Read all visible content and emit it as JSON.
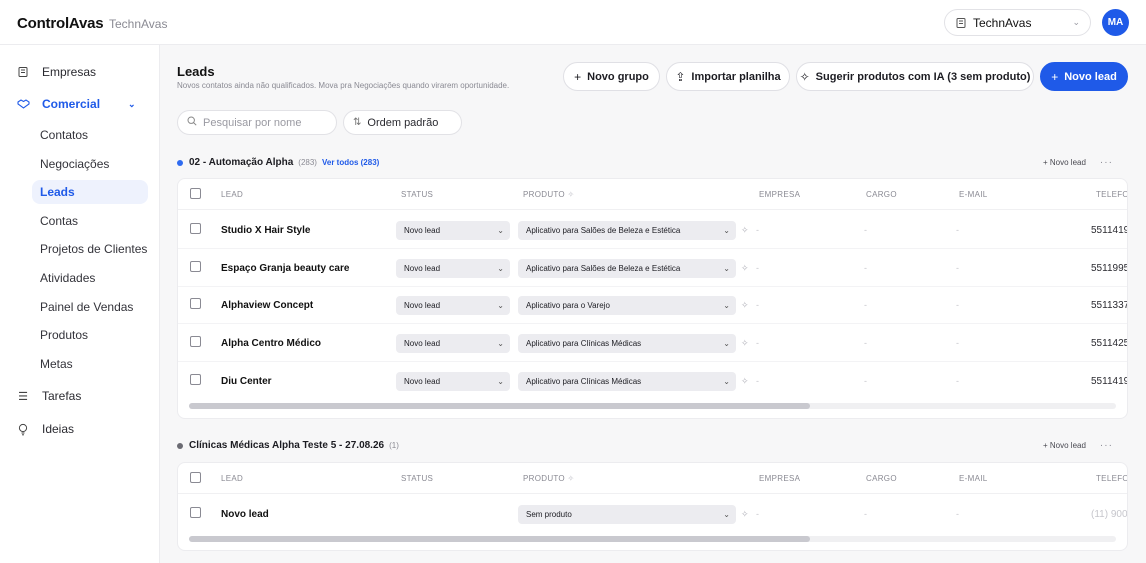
{
  "header": {
    "brand": "ControlAvas",
    "org_name": "TechnAvas",
    "org_select": "TechnAvas",
    "avatar": "MA"
  },
  "sidebar": {
    "empresas": "Empresas",
    "comercial": "Comercial",
    "sub_items": [
      "Contatos",
      "Negociações",
      "Leads",
      "Contas",
      "Projetos de Clientes",
      "Atividades",
      "Painel de Vendas",
      "Produtos",
      "Metas"
    ],
    "tarefas": "Tarefas",
    "ideias": "Ideias"
  },
  "page": {
    "title": "Leads",
    "subtitle": "Novos contatos ainda não qualificados. Mova pra Negociações quando virarem oportunidade.",
    "buttons": {
      "new_group": "Novo grupo",
      "import": "Importar planilha",
      "suggest": "Sugerir produtos com IA (3 sem produto)",
      "new_lead": "Novo lead"
    },
    "search_placeholder": "Pesquisar por nome",
    "order_label": "Ordem padrão"
  },
  "columns": [
    "LEAD",
    "STATUS",
    "PRODUTO",
    "EMPRESA",
    "CARGO",
    "E-MAIL",
    "TELEFO"
  ],
  "groups": [
    {
      "name": "02 - Automação Alpha",
      "count": "(283)",
      "see_all": "Ver todos (283)",
      "dot_color": "#2f6bf0",
      "new_lead": "+ Novo lead",
      "rows": [
        {
          "lead": "Studio X Hair Style",
          "status": "Novo lead",
          "product": "Aplicativo para Salões de Beleza e Estética",
          "empresa": "-",
          "cargo": "-",
          "email": "-",
          "phone": "5511419"
        },
        {
          "lead": "Espaço Granja beauty care",
          "status": "Novo lead",
          "product": "Aplicativo para Salões de Beleza e Estética",
          "empresa": "-",
          "cargo": "-",
          "email": "-",
          "phone": "5511995"
        },
        {
          "lead": "Alphaview Concept",
          "status": "Novo lead",
          "product": "Aplicativo para o Varejo",
          "empresa": "-",
          "cargo": "-",
          "email": "-",
          "phone": "5511337"
        },
        {
          "lead": "Alpha Centro Médico",
          "status": "Novo lead",
          "product": "Aplicativo para Clínicas Médicas",
          "empresa": "-",
          "cargo": "-",
          "email": "-",
          "phone": "5511425"
        },
        {
          "lead": "Diu Center",
          "status": "Novo lead",
          "product": "Aplicativo para Clínicas Médicas",
          "empresa": "-",
          "cargo": "-",
          "email": "-",
          "phone": "5511419"
        }
      ]
    },
    {
      "name": "Clínicas Médicas Alpha Teste 5 - 27.08.26",
      "count": "(1)",
      "dot_color": "#6b6b73",
      "new_lead": "+ Novo lead",
      "rows": [
        {
          "lead": "Novo lead",
          "product": "Sem produto",
          "empresa": "-",
          "cargo": "-",
          "email": "-",
          "phone": "(11) 900"
        }
      ]
    }
  ]
}
